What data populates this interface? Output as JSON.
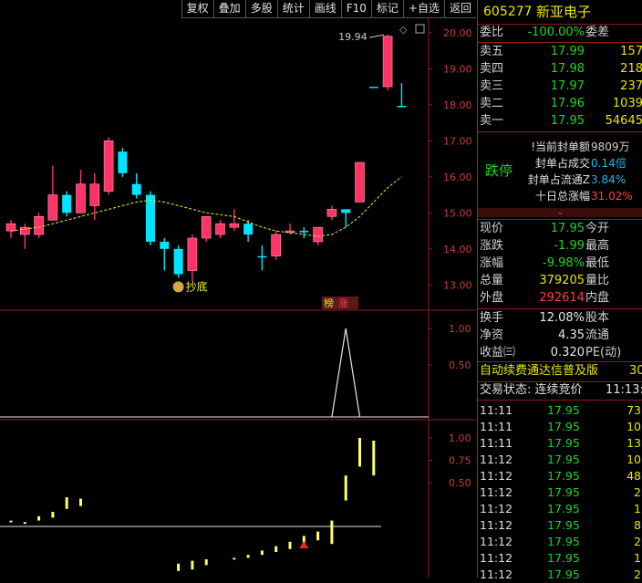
{
  "toolbar": {
    "buttons": [
      "复权",
      "叠加",
      "多股",
      "统计",
      "画线",
      "F10",
      "标记",
      "+自选",
      "返回"
    ]
  },
  "stock": {
    "code": "605277",
    "name": "新亚电子"
  },
  "chart_data": {
    "type": "candlestick",
    "price_axis": {
      "ticks": [
        "20.00",
        "19.00",
        "18.00",
        "17.00",
        "16.00",
        "15.00",
        "14.00",
        "13.00"
      ],
      "ylim": [
        12.3,
        20.4
      ]
    },
    "high_label": "19.94",
    "bottom_signal": "抄底",
    "badges": [
      "榜",
      "涨"
    ],
    "candles": [
      {
        "o": 14.5,
        "c": 14.7,
        "h": 14.8,
        "l": 14.3,
        "dir": "up"
      },
      {
        "o": 14.6,
        "c": 14.4,
        "h": 14.7,
        "l": 14.0,
        "dir": "up"
      },
      {
        "o": 14.4,
        "c": 14.9,
        "h": 15.0,
        "l": 14.3,
        "dir": "up"
      },
      {
        "o": 14.8,
        "c": 15.5,
        "h": 16.3,
        "l": 14.8,
        "dir": "up"
      },
      {
        "o": 15.0,
        "c": 15.5,
        "h": 15.6,
        "l": 14.9,
        "dir": "down"
      },
      {
        "o": 15.0,
        "c": 15.8,
        "h": 16.2,
        "l": 15.0,
        "dir": "up"
      },
      {
        "o": 15.2,
        "c": 15.8,
        "h": 16.1,
        "l": 14.8,
        "dir": "up"
      },
      {
        "o": 15.6,
        "c": 17.0,
        "h": 17.1,
        "l": 15.5,
        "dir": "up"
      },
      {
        "o": 16.7,
        "c": 16.1,
        "h": 16.8,
        "l": 16.0,
        "dir": "down"
      },
      {
        "o": 15.8,
        "c": 15.5,
        "h": 16.1,
        "l": 15.4,
        "dir": "down"
      },
      {
        "o": 15.5,
        "c": 14.2,
        "h": 15.6,
        "l": 14.1,
        "dir": "down"
      },
      {
        "o": 14.2,
        "c": 14.0,
        "h": 14.3,
        "l": 13.4,
        "dir": "down"
      },
      {
        "o": 14.0,
        "c": 13.3,
        "h": 14.1,
        "l": 13.2,
        "dir": "down"
      },
      {
        "o": 13.4,
        "c": 14.3,
        "h": 14.4,
        "l": 13.1,
        "dir": "up"
      },
      {
        "o": 14.3,
        "c": 14.9,
        "h": 14.9,
        "l": 14.2,
        "dir": "up"
      },
      {
        "o": 14.4,
        "c": 14.7,
        "h": 14.8,
        "l": 14.3,
        "dir": "up"
      },
      {
        "o": 14.6,
        "c": 14.7,
        "h": 15.1,
        "l": 14.5,
        "dir": "up"
      },
      {
        "o": 14.7,
        "c": 14.4,
        "h": 14.8,
        "l": 14.2,
        "dir": "down"
      },
      {
        "o": 13.8,
        "c": 13.8,
        "h": 14.1,
        "l": 13.4,
        "dir": "down"
      },
      {
        "o": 13.8,
        "c": 14.4,
        "h": 14.5,
        "l": 13.7,
        "dir": "up"
      },
      {
        "o": 14.5,
        "c": 14.5,
        "h": 14.7,
        "l": 14.4,
        "dir": "up"
      },
      {
        "o": 14.5,
        "c": 14.5,
        "h": 14.6,
        "l": 14.3,
        "dir": "down"
      },
      {
        "o": 14.2,
        "c": 14.6,
        "h": 14.6,
        "l": 14.1,
        "dir": "up"
      },
      {
        "o": 14.9,
        "c": 15.1,
        "h": 15.2,
        "l": 14.8,
        "dir": "up"
      },
      {
        "o": 15.0,
        "c": 15.1,
        "h": 15.1,
        "l": 14.6,
        "dir": "down"
      },
      {
        "o": 15.3,
        "c": 16.4,
        "h": 16.4,
        "l": 15.3,
        "dir": "up"
      },
      {
        "o": 18.5,
        "c": 18.5,
        "h": 18.5,
        "l": 18.5,
        "dir": "down"
      },
      {
        "o": 18.5,
        "c": 19.9,
        "h": 19.94,
        "l": 18.4,
        "dir": "up"
      },
      {
        "o": 17.97,
        "c": 17.95,
        "h": 18.6,
        "l": 17.95,
        "dir": "down"
      }
    ],
    "ma": [
      14.5,
      14.55,
      14.6,
      14.7,
      14.8,
      14.9,
      15.0,
      15.1,
      15.2,
      15.3,
      15.35,
      15.3,
      15.2,
      15.1,
      15.0,
      14.95,
      14.9,
      14.75,
      14.6,
      14.5,
      14.45,
      14.4,
      14.35,
      14.4,
      14.6,
      14.9,
      15.3,
      15.7,
      16.0
    ],
    "panel2": {
      "ticks": [
        "1.00",
        "0.50"
      ],
      "peak_index": 24,
      "peak_value": 1.0
    },
    "panel3": {
      "ticks": [
        "1.00",
        "0.75",
        "0.50"
      ],
      "bars": [
        {
          "i": 0,
          "lo": 0.27,
          "hi": 0.28,
          "side": "upper"
        },
        {
          "i": 1,
          "lo": 0.26,
          "hi": 0.27,
          "side": "upper"
        },
        {
          "i": 2,
          "lo": 0.28,
          "hi": 0.31,
          "side": "upper"
        },
        {
          "i": 3,
          "lo": 0.3,
          "hi": 0.34,
          "side": "upper"
        },
        {
          "i": 4,
          "lo": 0.36,
          "hi": 0.44,
          "side": "upper"
        },
        {
          "i": 5,
          "lo": 0.38,
          "hi": 0.43,
          "side": "upper"
        },
        {
          "i": 12,
          "lo": -0.18,
          "hi": -0.13,
          "side": "lower"
        },
        {
          "i": 13,
          "lo": -0.17,
          "hi": -0.11,
          "side": "lower"
        },
        {
          "i": 14,
          "lo": -0.14,
          "hi": -0.1,
          "side": "lower"
        },
        {
          "i": 16,
          "lo": -0.1,
          "hi": -0.09,
          "side": "lower"
        },
        {
          "i": 17,
          "lo": -0.09,
          "hi": -0.07,
          "side": "lower"
        },
        {
          "i": 18,
          "lo": -0.07,
          "hi": -0.04,
          "side": "lower"
        },
        {
          "i": 19,
          "lo": -0.05,
          "hi": -0.01,
          "side": "lower"
        },
        {
          "i": 20,
          "lo": -0.03,
          "hi": 0.02,
          "side": "lower"
        },
        {
          "i": 21,
          "lo": 0.0,
          "hi": 0.06,
          "side": "lower"
        },
        {
          "i": 22,
          "lo": 0.03,
          "hi": 0.09,
          "side": "lower"
        },
        {
          "i": 23,
          "lo": 0.12,
          "hi": 0.28,
          "side": "upper"
        },
        {
          "i": 24,
          "lo": 0.3,
          "hi": 0.58,
          "side": "upper"
        },
        {
          "i": 25,
          "lo": 0.68,
          "hi": 1.0,
          "side": "upper"
        },
        {
          "i": 26,
          "lo": 0.58,
          "hi": 0.97,
          "side": "upper"
        }
      ]
    }
  },
  "panel": {
    "weibi_label": "委比",
    "weibi_value": "-100.00%",
    "weicha_label": "委差",
    "asks": [
      {
        "label": "卖五",
        "price": "17.99",
        "vol": "157"
      },
      {
        "label": "卖四",
        "price": "17.98",
        "vol": "218"
      },
      {
        "label": "卖三",
        "price": "17.97",
        "vol": "237"
      },
      {
        "label": "卖二",
        "price": "17.96",
        "vol": "1039"
      },
      {
        "label": "卖一",
        "price": "17.95",
        "vol": "54645"
      }
    ],
    "limit_status": "跌停",
    "seal": [
      {
        "label": "!当前封单额",
        "value": "9809万"
      },
      {
        "label": "封单占成交",
        "value": "0.14倍"
      },
      {
        "label": "封单占流通Z",
        "value": "3.84%"
      },
      {
        "label": "十日总涨幅",
        "value": "31.02%"
      }
    ],
    "expand_icon": "chevron-down-icon",
    "quote": [
      {
        "label": "现价",
        "value": "17.95",
        "label2": "今开"
      },
      {
        "label": "涨跌",
        "value": "-1.99",
        "label2": "最高"
      },
      {
        "label": "涨幅",
        "value": "-9.98%",
        "label2": "最低"
      },
      {
        "label": "总量",
        "value": "379205",
        "label2": "量比"
      },
      {
        "label": "外盘",
        "value": "292614",
        "label2": "内盘"
      }
    ],
    "quote2": [
      {
        "label": "换手",
        "value": "12.08%",
        "label2": "股本"
      },
      {
        "label": "净资",
        "value": "4.35",
        "label2": "流通"
      },
      {
        "label": "收益㈢",
        "value": "0.320",
        "label2": "PE(动)"
      }
    ],
    "ad_text": "自动续费通达信普及版",
    "ad_tail": "30",
    "trade_status": "交易状态: 连续竞价",
    "trade_time": "11:13:",
    "ticks": [
      {
        "t": "11:11",
        "p": "17.95",
        "v": "73"
      },
      {
        "t": "11:11",
        "p": "17.95",
        "v": "10"
      },
      {
        "t": "11:11",
        "p": "17.95",
        "v": "13"
      },
      {
        "t": "11:12",
        "p": "17.95",
        "v": "10"
      },
      {
        "t": "11:12",
        "p": "17.95",
        "v": "48"
      },
      {
        "t": "11:12",
        "p": "17.95",
        "v": "2"
      },
      {
        "t": "11:12",
        "p": "17.95",
        "v": "1"
      },
      {
        "t": "11:12",
        "p": "17.95",
        "v": "8"
      },
      {
        "t": "11:12",
        "p": "17.95",
        "v": "2"
      },
      {
        "t": "11:12",
        "p": "17.95",
        "v": "1"
      },
      {
        "t": "11:12",
        "p": "17.95",
        "v": "2"
      }
    ],
    "colors": {
      "up": "#ff3366",
      "down": "#00e5ff",
      "limit": "#22d322",
      "ask_vol": "#e8e800"
    }
  }
}
